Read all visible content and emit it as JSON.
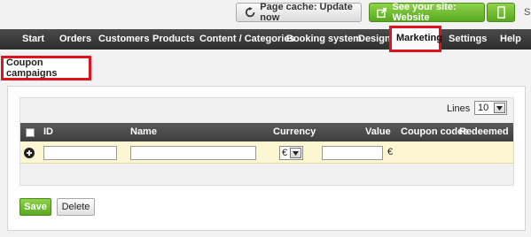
{
  "topbar": {
    "cache_button": "Page cache: Update now",
    "site_button": "See your site: Website",
    "truncated_text": "S"
  },
  "nav": {
    "items": [
      "Start",
      "Orders",
      "Customers",
      "Products",
      "Content / Categories",
      "Booking system",
      "Design",
      "Marketing",
      "Settings",
      "Help"
    ],
    "active": "Marketing"
  },
  "page": {
    "title": "Coupon campaigns"
  },
  "lines": {
    "label": "Lines",
    "value": "10"
  },
  "table": {
    "columns": [
      "ID",
      "Name",
      "Currency",
      "Value",
      "Coupon codes",
      "Redeemed"
    ],
    "new_row": {
      "id": "",
      "name": "",
      "currency": "€",
      "value": "",
      "value_suffix": "€"
    }
  },
  "actions": {
    "save": "Save",
    "delete": "Delete"
  },
  "colors": {
    "accent_green": "#5aa920",
    "highlight_red": "#e0141e",
    "nav_dark": "#333333",
    "new_row_bg": "#fdf6d2"
  }
}
